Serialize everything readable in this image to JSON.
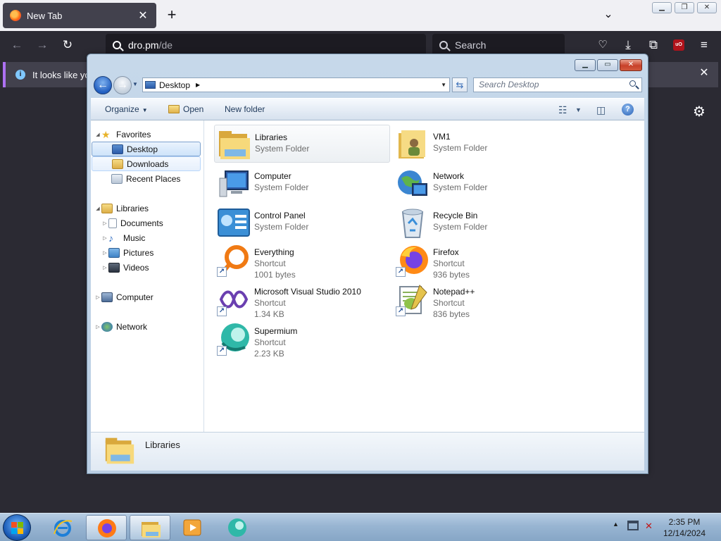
{
  "browser": {
    "tab_title": "New Tab",
    "url_host": "dro.pm",
    "url_path": "/de",
    "search_placeholder": "Search",
    "notice_text": "It looks like you"
  },
  "explorer": {
    "address": "Desktop",
    "search_placeholder": "Search Desktop",
    "toolbar": {
      "organize": "Organize",
      "open": "Open",
      "new_folder": "New folder"
    },
    "nav": {
      "favorites": "Favorites",
      "desktop": "Desktop",
      "downloads": "Downloads",
      "recent_places": "Recent Places",
      "libraries": "Libraries",
      "documents": "Documents",
      "music": "Music",
      "pictures": "Pictures",
      "videos": "Videos",
      "computer": "Computer",
      "network": "Network"
    },
    "items": [
      {
        "name": "Libraries",
        "type": "System Folder",
        "size": ""
      },
      {
        "name": "VM1",
        "type": "System Folder",
        "size": ""
      },
      {
        "name": "Computer",
        "type": "System Folder",
        "size": ""
      },
      {
        "name": "Network",
        "type": "System Folder",
        "size": ""
      },
      {
        "name": "Control Panel",
        "type": "System Folder",
        "size": ""
      },
      {
        "name": "Recycle Bin",
        "type": "System Folder",
        "size": ""
      },
      {
        "name": "Everything",
        "type": "Shortcut",
        "size": "1001 bytes"
      },
      {
        "name": "Firefox",
        "type": "Shortcut",
        "size": "936 bytes"
      },
      {
        "name": "Microsoft Visual Studio 2010",
        "type": "Shortcut",
        "size": "1.34 KB"
      },
      {
        "name": "Notepad++",
        "type": "Shortcut",
        "size": "836 bytes"
      },
      {
        "name": "Supermium",
        "type": "Shortcut",
        "size": "2.23 KB"
      }
    ],
    "details": {
      "label": "Libraries"
    }
  },
  "taskbar": {
    "time": "2:35 PM",
    "date": "12/14/2024"
  },
  "colors": {
    "firefox_dark": "#2b2a33",
    "accent_blue": "#215ec0",
    "selection": "#cde3fa"
  }
}
